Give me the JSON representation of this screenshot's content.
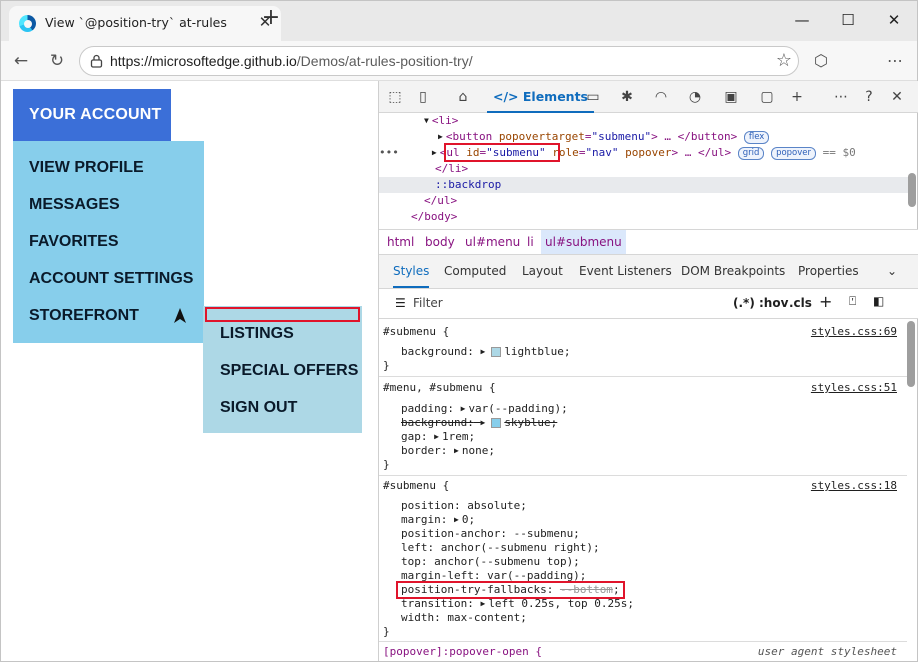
{
  "browser": {
    "tab_title": "View `@position-try` at-rules",
    "url_host": "https://microsoftedge.github.io",
    "url_path": "/Demos/at-rules-position-try/"
  },
  "page": {
    "account_button": "YOUR ACCOUNT",
    "menu_items": [
      "VIEW PROFILE",
      "MESSAGES",
      "FAVORITES",
      "ACCOUNT SETTINGS",
      "STOREFRONT"
    ],
    "submenu_items": [
      "LISTINGS",
      "SPECIAL OFFERS",
      "SIGN OUT"
    ]
  },
  "devtools": {
    "elements_tab": "Elements",
    "dom": {
      "line1": "<li>",
      "button_tag_open": "<button ",
      "button_attr": "popovertarget",
      "button_val": "\"submenu\"",
      "button_close": "> … </button>",
      "badge_flex": "flex",
      "ul_open": "<ul ",
      "ul_id_attr": "id",
      "ul_id_val": "\"submenu\"",
      "ul_role": " role",
      "ul_role_val": "\"nav\"",
      "ul_popover": " popover",
      "ul_close": "> … </ul>",
      "badge_grid": "grid",
      "badge_popover": "popover",
      "eq_s0": "== $0",
      "close_li": "</li>",
      "backdrop": "::backdrop",
      "close_ul": "</ul>",
      "close_body": "</body>"
    },
    "breadcrumbs": [
      "html",
      "body",
      "ul#menu",
      "li",
      "ul#submenu"
    ],
    "styles_tabs": [
      "Styles",
      "Computed",
      "Layout",
      "Event Listeners",
      "DOM Breakpoints",
      "Properties"
    ],
    "filter_placeholder": "Filter",
    "filter_tools": [
      ":hov",
      ".cls"
    ],
    "rules": {
      "r1_selector": "#submenu {",
      "r1_source": "styles.css:69",
      "r1_prop": "background",
      "r1_val": "lightblue;",
      "r2_selector": "#menu, #submenu {",
      "r2_source": "styles.css:51",
      "r2_padding": "padding",
      "r2_padding_val": "var(--padding);",
      "r2_bg": "background:",
      "r2_bg_val": "skyblue;",
      "r2_gap": "gap",
      "r2_gap_val": "1rem;",
      "r2_border": "border",
      "r2_border_val": "none;",
      "r3_selector": "#submenu {",
      "r3_source": "styles.css:18",
      "r3_position": "position: absolute;",
      "r3_margin": "margin",
      "r3_margin_val": "0;",
      "r3_anchor": "position-anchor: --submenu;",
      "r3_left": "left: anchor(--submenu right);",
      "r3_top": "top: anchor(--submenu top);",
      "r3_margin_left": "margin-left: var(--padding);",
      "r3_fallbacks": "position-try-fallbacks:",
      "r3_fallbacks_val": "--bottom",
      "r3_transition": "transition",
      "r3_transition_val": "left 0.25s, top 0.25s;",
      "r3_width": "width: max-content;",
      "r4_selector": "[popover]:popover-open {",
      "r4_source": "user agent stylesheet"
    }
  }
}
